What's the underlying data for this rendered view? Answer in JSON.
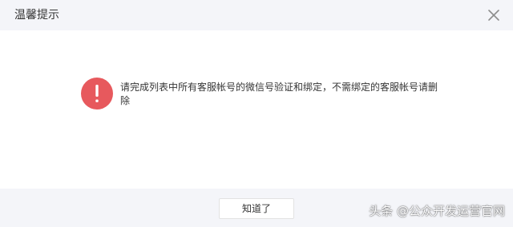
{
  "dialog": {
    "title": "温馨提示",
    "close_icon": "close-icon",
    "warning_icon": "exclamation-circle-icon",
    "warning_color": "#e7595d",
    "message": "请完成列表中所有客服帐号的微信号验证和绑定，不需绑定的客服帐号请删除",
    "confirm_label": "知道了"
  },
  "watermark": {
    "text": "头条 @公众开发运营官网"
  }
}
